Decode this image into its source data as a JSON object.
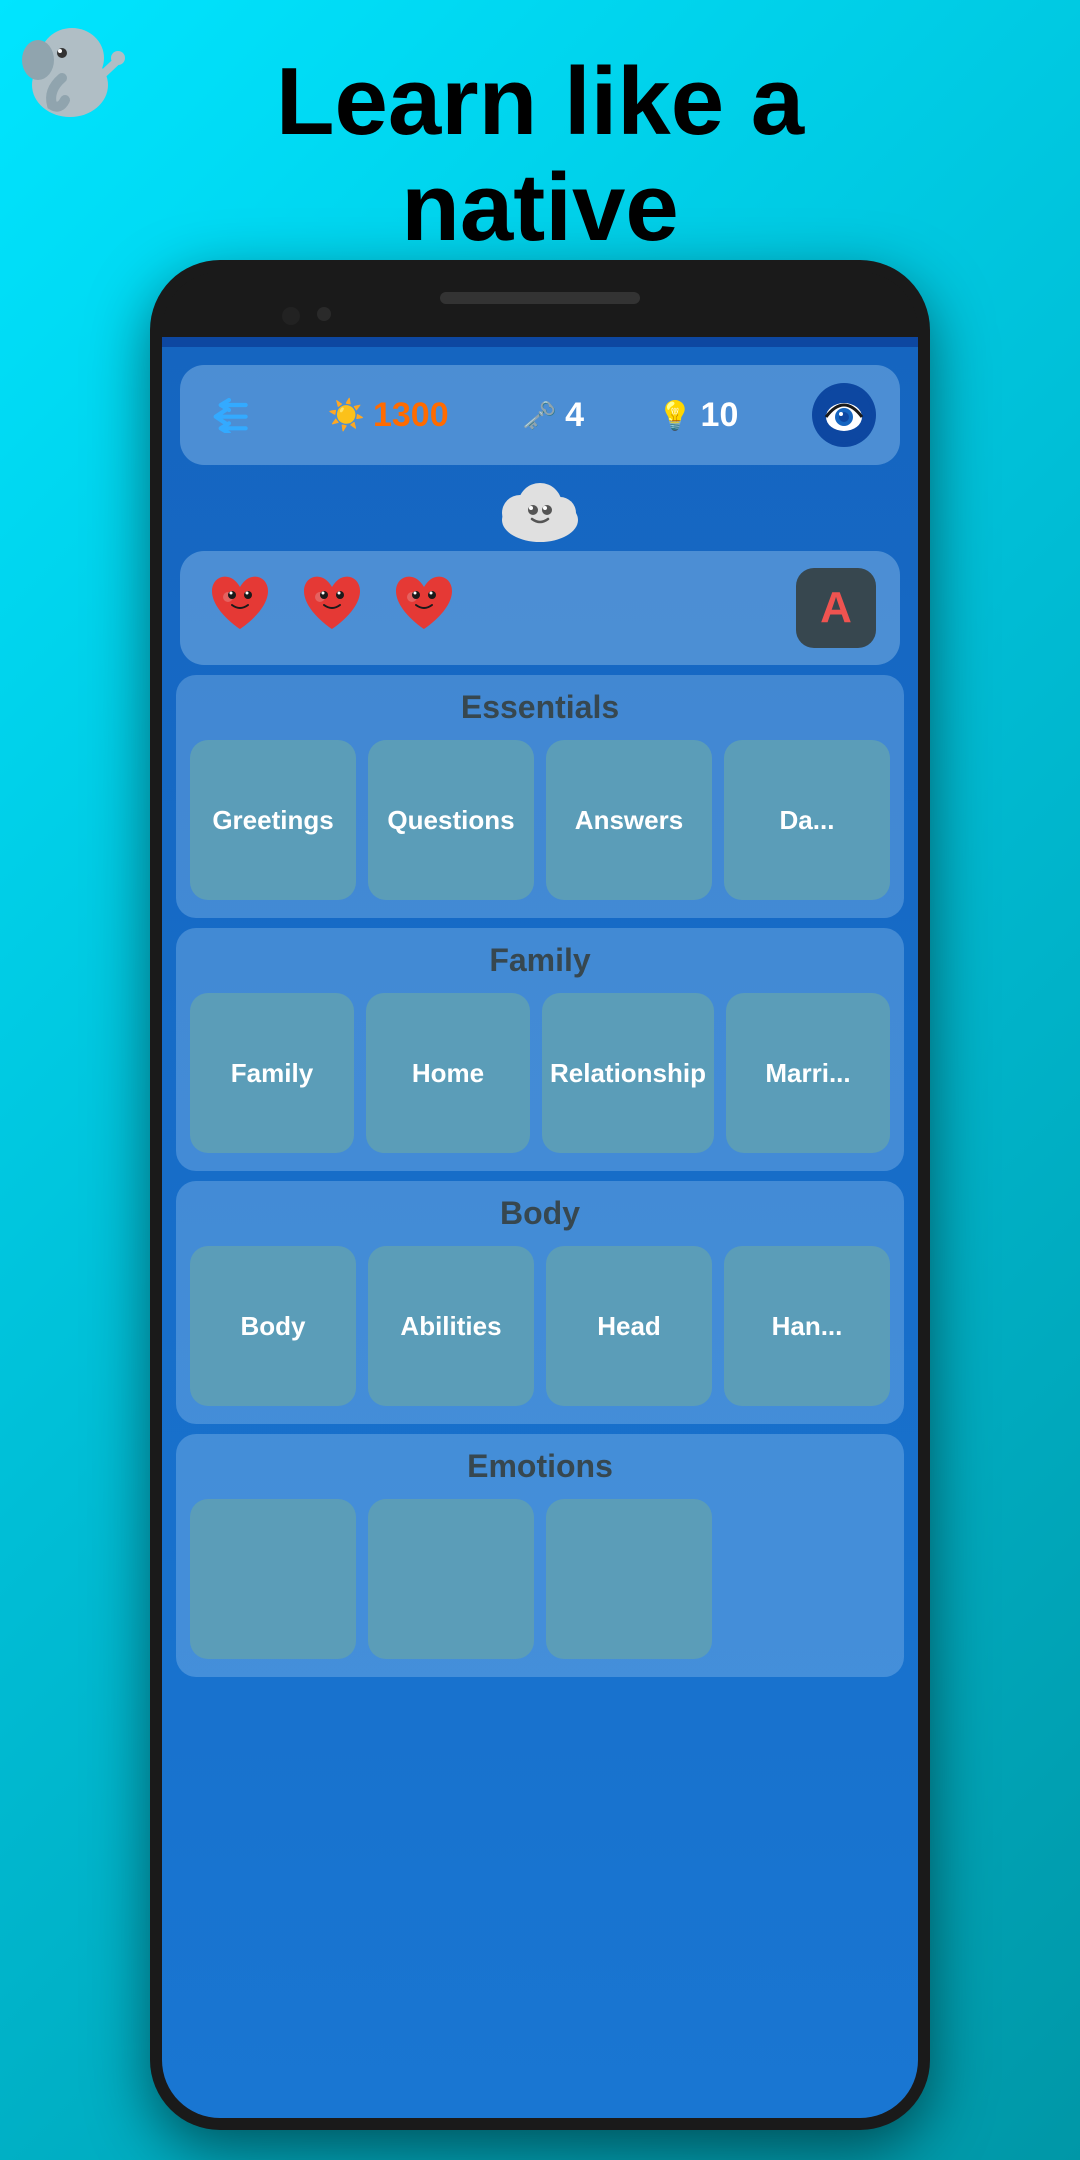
{
  "headline": {
    "line1": "Learn like a",
    "line2": "native"
  },
  "stats": {
    "xp": "1300",
    "keys": "4",
    "gems": "10"
  },
  "hearts": {
    "count": 3,
    "heart_emoji": "❤️"
  },
  "sections": [
    {
      "id": "essentials",
      "title": "Essentials",
      "items": [
        "Greetings",
        "Questions",
        "Answers",
        "Da..."
      ]
    },
    {
      "id": "family",
      "title": "Family",
      "items": [
        "Family",
        "Home",
        "Relationship",
        "Marri..."
      ]
    },
    {
      "id": "body",
      "title": "Body",
      "items": [
        "Body",
        "Abilities",
        "Head",
        "Han..."
      ]
    },
    {
      "id": "emotions",
      "title": "Emotions",
      "items": [
        "",
        "",
        ""
      ]
    }
  ],
  "icons": {
    "back_arrow": "back-arrow",
    "sun": "☀️",
    "key": "🗝️",
    "bulb": "💡",
    "eye": "eye-icon",
    "cloud_mascot": "cloud-mascot",
    "vocab_letter": "A"
  }
}
